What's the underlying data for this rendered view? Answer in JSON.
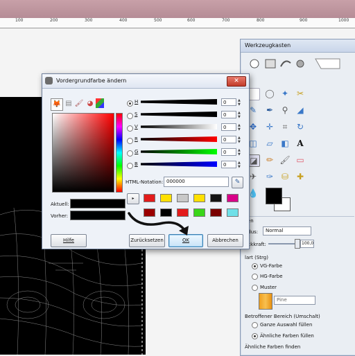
{
  "ruler": {
    "ticks": [
      "100",
      "200",
      "300",
      "400",
      "500",
      "600",
      "700",
      "800",
      "900",
      "1000"
    ]
  },
  "toolbox": {
    "title": "Werkzeugkasten",
    "panel": {
      "header": "llen",
      "mode_label": "odus:",
      "mode_value": "Normal",
      "opacity_label": "eckkraft:",
      "opacity_value": "100,0",
      "fill_type_label": "lart  (Strg)",
      "fill_options": [
        "VG-Farbe",
        "HG-Farbe",
        "Muster"
      ],
      "pattern_name": "Pine",
      "affected_area_label": "Betroffener Bereich  (Umschalt)",
      "area_options": [
        "Ganze Auswahl füllen",
        "Ähnliche Farben füllen"
      ],
      "find_similar_label": "Ähnliche Farben finden"
    }
  },
  "dialog": {
    "title": "Vordergrundfarbe ändern",
    "close_glyph": "✕",
    "sliders": [
      {
        "key": "H",
        "value": "0",
        "color_a": "#000000",
        "color_b": "#000000"
      },
      {
        "key": "S",
        "value": "0",
        "color_a": "#000000",
        "color_b": "#000000"
      },
      {
        "key": "V",
        "value": "0",
        "color_a": "#000000",
        "color_b": "#ffffff"
      },
      {
        "key": "R",
        "value": "0",
        "color_a": "#000000",
        "color_b": "#ff0000"
      },
      {
        "key": "G",
        "value": "0",
        "color_a": "#000000",
        "color_b": "#00ff00"
      },
      {
        "key": "B",
        "value": "0",
        "color_a": "#000000",
        "color_b": "#0000ff"
      }
    ],
    "html_notation_label": "HTML-Notation:",
    "html_notation_value": "000000",
    "current_label": "Aktuell:",
    "previous_label": "Vorher:",
    "history_colors_row1": [
      "#e31b1b",
      "#ffe000",
      "#c8c8c8",
      "#ffe000",
      "#141414",
      "#d80088"
    ],
    "history_colors_row2": [
      "#9a0000",
      "#000000",
      "#e31b1b",
      "#3ad61a",
      "#7a0000",
      "#6fe0e8"
    ],
    "help_label": "Hilfe",
    "reset_label": "Zurücksetzen",
    "ok_label": "OK",
    "cancel_label": "Abbrechen"
  }
}
